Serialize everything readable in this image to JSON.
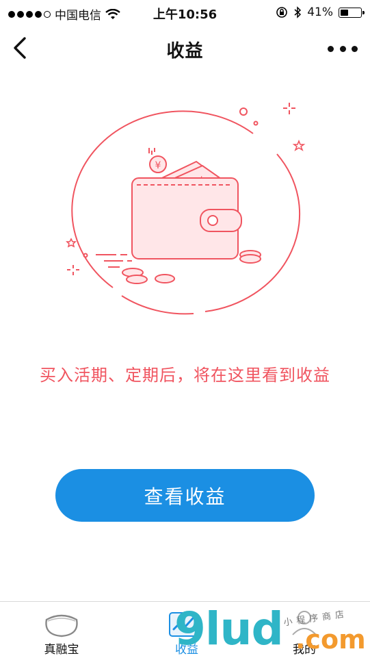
{
  "status_bar": {
    "carrier": "中国电信",
    "time": "上午10:56",
    "battery": "41%",
    "battery_level": 0.41,
    "signal_bars_filled": 4,
    "signal_bars_total": 5
  },
  "nav": {
    "title": "收益",
    "back_icon": "chevron-left-icon",
    "more_icon": "more-dots-icon"
  },
  "illustration": {
    "icon": "wallet-coins-icon",
    "currency_symbol": "¥",
    "accent_color": "#f0545f"
  },
  "empty_state": {
    "message": "买入活期、定期后，将在这里看到收益"
  },
  "cta": {
    "label": "查看收益",
    "color": "#1b8fe3"
  },
  "tabbar": {
    "tabs": [
      {
        "label": "真融宝",
        "icon": "bean-icon",
        "active": false
      },
      {
        "label": "收益",
        "icon": "chart-icon",
        "active": true
      },
      {
        "label": "我的",
        "icon": "user-icon",
        "active": false
      }
    ]
  },
  "watermark": {
    "brand": "9lud",
    "suffix": ".com",
    "tagline": "小程序商店"
  }
}
